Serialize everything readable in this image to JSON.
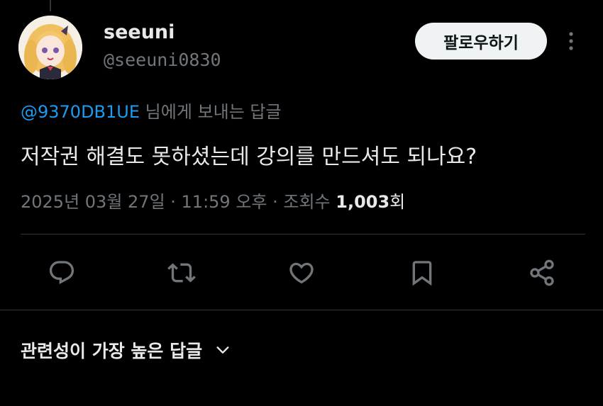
{
  "author": {
    "name": "seeuni",
    "handle": "@seeuni0830"
  },
  "follow_button": "팔로우하기",
  "reply_context": {
    "mention": "@9370DB1UE",
    "suffix": " 님에게 보내는 답글"
  },
  "tweet_text": "저작권 해결도 못하셨는데 강의를 만드셔도 되나요?",
  "meta": {
    "timestamp": "2025년 03월 27일 · 11:59 오후 · 조회수 ",
    "views_count": "1,003",
    "views_suffix": "회"
  },
  "actions": [
    "reply-icon",
    "retweet-icon",
    "like-icon",
    "bookmark-icon",
    "share-icon"
  ],
  "sort": {
    "label": "관련성이 가장 높은 답글"
  },
  "colors": {
    "background": "#000000",
    "text": "#e7e9ea",
    "secondary": "#71767b",
    "link": "#1d9bf0",
    "button_bg": "#eff3f4"
  }
}
